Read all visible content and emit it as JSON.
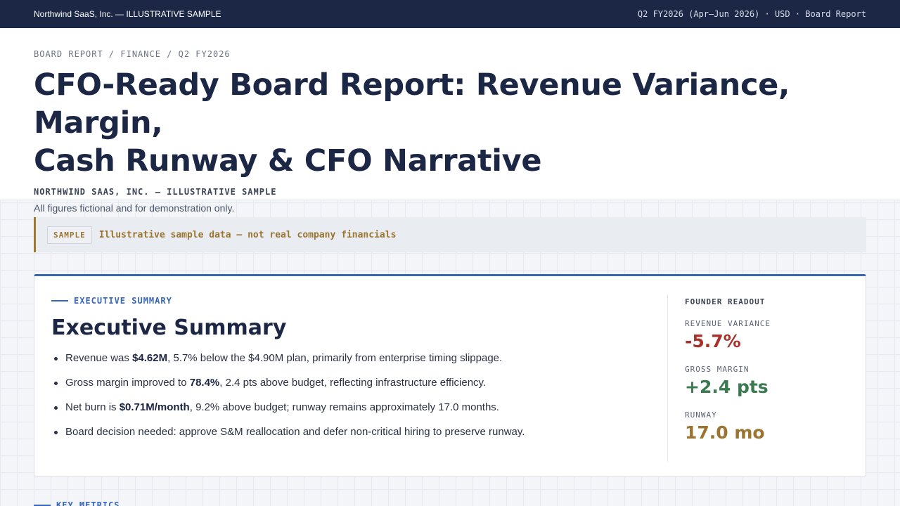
{
  "topbar": {
    "brand": "Northwind SaaS, Inc. — ILLUSTRATIVE SAMPLE",
    "meta": "Q2 FY2026 (Apr–Jun 2026) · USD · Board Report"
  },
  "header": {
    "breadcrumb": "BOARD REPORT / FINANCE / Q2 FY2026",
    "title_line1": "CFO-Ready Board Report: Revenue Variance, Margin,",
    "title_line2": "Cash Runway & CFO Narrative",
    "company": "NORTHWIND SAAS, INC. — ILLUSTRATIVE SAMPLE",
    "disclaimer": "All figures fictional and for demonstration only."
  },
  "banner": {
    "badge": "SAMPLE",
    "text": "Illustrative sample data — not real company financials"
  },
  "summary": {
    "section_label": "EXECUTIVE SUMMARY",
    "title": "Executive Summary",
    "bullets": [
      {
        "pre": "Revenue was ",
        "bold": "$4.62M",
        "post": ", 5.7% below the $4.90M plan, primarily from enterprise timing slippage."
      },
      {
        "pre": "Gross margin improved to ",
        "bold": "78.4%",
        "post": ", 2.4 pts above budget, reflecting infrastructure efficiency."
      },
      {
        "pre": "Net burn is ",
        "bold": "$0.71M/month",
        "post": ", 9.2% above budget; runway remains approximately 17.0 months."
      },
      {
        "pre": "Board decision needed: approve S&M reallocation and defer non-critical hiring to preserve runway.",
        "bold": "",
        "post": ""
      }
    ]
  },
  "readout": {
    "title": "FOUNDER READOUT",
    "metrics": [
      {
        "label": "REVENUE VARIANCE",
        "value": "-5.7%",
        "color": "#a8322b"
      },
      {
        "label": "GROSS MARGIN",
        "value": "+2.4 pts",
        "color": "#3a7a4e"
      },
      {
        "label": "RUNWAY",
        "value": "17.0 mo",
        "color": "#9a7430"
      }
    ]
  },
  "next_section": {
    "label": "KEY METRICS"
  }
}
